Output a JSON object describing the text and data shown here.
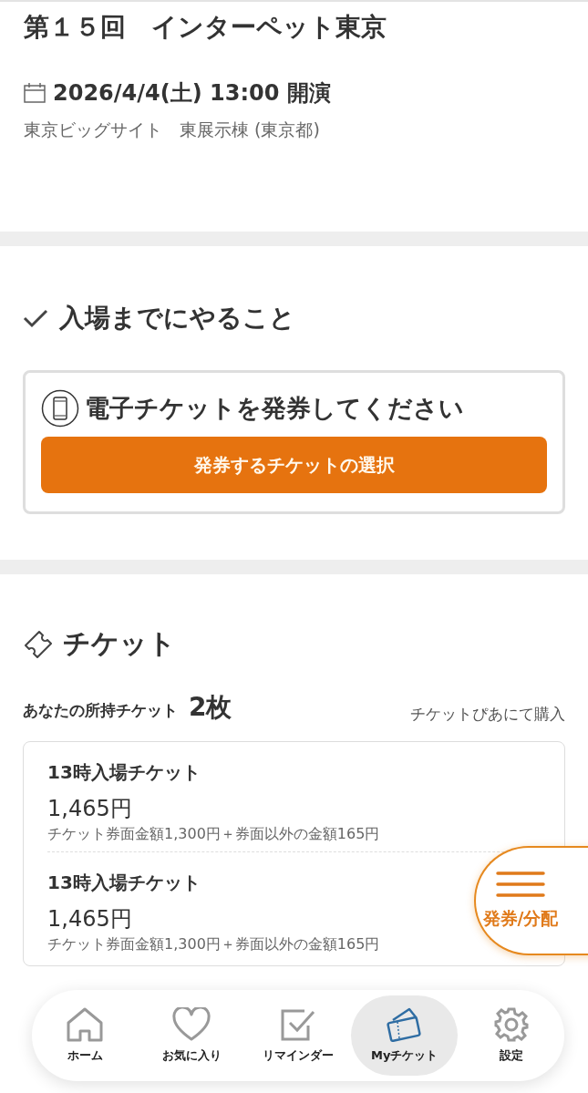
{
  "event": {
    "title": "第１５回　インターペット東京",
    "datetime": "2026/4/4(土) 13:00 開演",
    "venue": "東京ビッグサイト　東展示棟 (東京都)"
  },
  "todo": {
    "heading": "入場までにやること",
    "task": "電子チケットを発券してください",
    "button": "発券するチケットの選択"
  },
  "tickets": {
    "heading": "チケット",
    "owned_label": "あなたの所持チケット",
    "owned_count": "2",
    "owned_unit": "枚",
    "purchase_link": "チケットぴあにて購入",
    "items": [
      {
        "name": "13時入場チケット",
        "price": "1,465円",
        "breakdown": "チケット券面金額1,300円＋券面以外の金額165円"
      },
      {
        "name": "13時入場チケット",
        "price": "1,465円",
        "breakdown": "チケット券面金額1,300円＋券面以外の金額165円"
      }
    ]
  },
  "fab": {
    "label": "発券/分配"
  },
  "nav": [
    {
      "label": "ホーム",
      "kind": "home",
      "selected": false
    },
    {
      "label": "お気に入り",
      "kind": "favorite",
      "selected": false
    },
    {
      "label": "リマインダー",
      "kind": "reminder",
      "selected": false
    },
    {
      "label": "Myチケット",
      "kind": "ticket",
      "selected": true
    },
    {
      "label": "設定",
      "kind": "settings",
      "selected": false
    }
  ]
}
